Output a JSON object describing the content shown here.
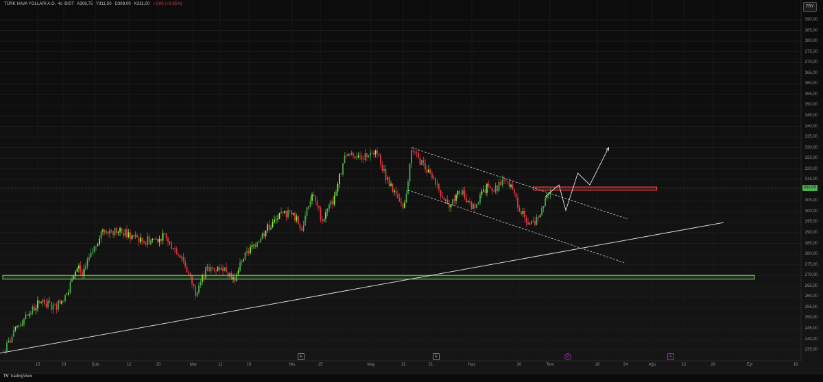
{
  "header": {
    "symbol": "TÜRK HAVA YOLLARI A.O.",
    "timeframe": "4s",
    "exchange": "BIST",
    "open": "A308,75",
    "high": "Y311,50",
    "low": "D308,00",
    "close": "K311,00",
    "change": "+2,00 (+0,65%)"
  },
  "currency": "TRY",
  "last_price_label": "311,00",
  "footer": {
    "logo_text": "tradingView"
  },
  "events": [
    {
      "label": "E",
      "kind": "earnings"
    },
    {
      "label": "E",
      "kind": "earnings"
    },
    {
      "label": "D",
      "kind": "dividend"
    },
    {
      "label": "E",
      "kind": "earnings-upcoming"
    }
  ],
  "colors": {
    "background": "#0e0e0e",
    "up": "#4caf50",
    "down": "#f23645",
    "upLime": "#8bff3c",
    "zone_border": "#7cd65a",
    "resistance_zone": "#f23645",
    "trend_line": "#d9d9d9"
  },
  "chart_data": {
    "type": "candlestick",
    "y_axis": {
      "ticks": [
        "390,00",
        "385,00",
        "380,00",
        "375,00",
        "370,00",
        "365,00",
        "360,00",
        "355,00",
        "350,00",
        "345,00",
        "340,00",
        "335,00",
        "330,00",
        "325,00",
        "320,00",
        "315,00",
        "310,00",
        "305,00",
        "300,00",
        "295,00",
        "290,00",
        "285,00",
        "280,00",
        "275,00",
        "270,00",
        "265,00",
        "260,00",
        "255,00",
        "250,00",
        "245,00",
        "240,00",
        "235,00"
      ],
      "ylim": [
        233,
        393
      ]
    },
    "x_axis": {
      "ticks": [
        "15",
        "23",
        "Şub",
        "12",
        "20",
        "Mar",
        "11",
        "19",
        "Nis",
        "15",
        "May",
        "13",
        "21",
        "Haz",
        "20",
        "Tem",
        "16",
        "24",
        "Ağu",
        "12",
        "20",
        "Eyl",
        "16"
      ]
    },
    "last_price": 311.0,
    "anchors": [
      [
        0,
        234
      ],
      [
        10,
        248
      ],
      [
        22,
        258
      ],
      [
        30,
        255
      ],
      [
        38,
        262
      ],
      [
        40,
        270
      ],
      [
        44,
        274
      ],
      [
        46,
        270
      ],
      [
        58,
        292
      ],
      [
        70,
        290
      ],
      [
        82,
        286
      ],
      [
        94,
        288
      ],
      [
        104,
        279
      ],
      [
        112,
        262
      ],
      [
        118,
        272
      ],
      [
        128,
        274
      ],
      [
        135,
        268
      ],
      [
        140,
        278
      ],
      [
        154,
        292
      ],
      [
        160,
        297
      ],
      [
        168,
        300
      ],
      [
        174,
        292
      ],
      [
        180,
        308
      ],
      [
        186,
        296
      ],
      [
        192,
        305
      ],
      [
        200,
        327
      ],
      [
        210,
        326
      ],
      [
        218,
        329
      ],
      [
        222,
        318
      ],
      [
        230,
        305
      ],
      [
        234,
        303
      ],
      [
        238,
        328
      ],
      [
        244,
        323
      ],
      [
        252,
        313
      ],
      [
        260,
        302
      ],
      [
        266,
        310
      ],
      [
        274,
        302
      ],
      [
        282,
        311
      ],
      [
        288,
        311
      ],
      [
        292,
        315
      ],
      [
        296,
        311
      ],
      [
        302,
        300
      ],
      [
        306,
        293
      ],
      [
        312,
        297
      ],
      [
        316,
        307
      ],
      [
        319,
        311
      ]
    ],
    "support_zone": {
      "low": 268.2,
      "high": 270.0
    },
    "resistance_zone": {
      "low": 310.0,
      "high": 311.5
    },
    "horizontal_line": 311.0,
    "rising_trendline": [
      [
        -12,
        232
      ],
      [
        420,
        294.8
      ]
    ],
    "channel_upper": [
      [
        238,
        330
      ],
      [
        364,
        296.5
      ]
    ],
    "channel_lower": [
      [
        236,
        310
      ],
      [
        362,
        276
      ]
    ],
    "projection_path": [
      [
        316,
        307.0
      ],
      [
        324,
        312.5
      ],
      [
        328,
        300.5
      ],
      [
        335,
        318.0
      ],
      [
        342,
        312.5
      ],
      [
        353,
        330.0
      ]
    ]
  }
}
